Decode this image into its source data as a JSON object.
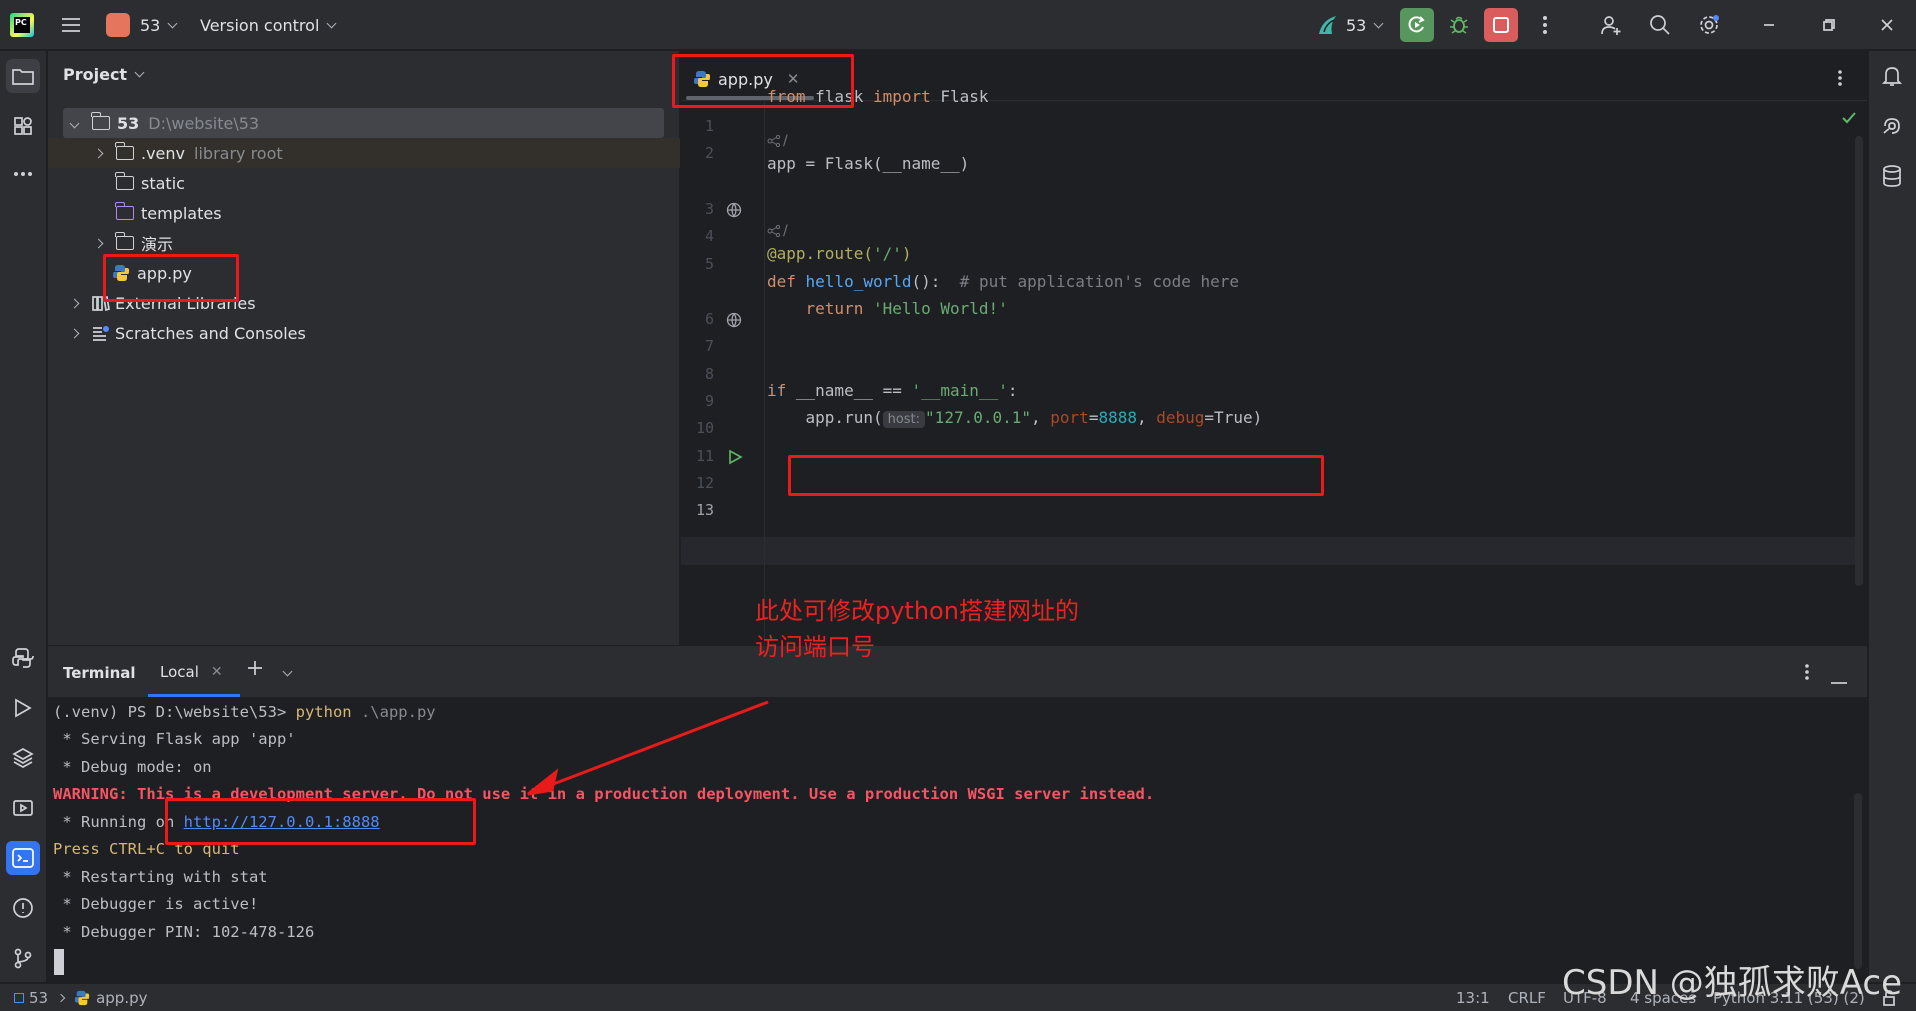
{
  "titlebar": {
    "project_badge": "53",
    "project_name": "53",
    "vcs_label": "Version control",
    "run_config": "53"
  },
  "project_panel": {
    "title": "Project",
    "tree": [
      {
        "label": "53",
        "path": "D:\\website\\53"
      },
      {
        "label": ".venv",
        "note": "library root"
      },
      {
        "label": "static"
      },
      {
        "label": "templates"
      },
      {
        "label": "演示"
      },
      {
        "label": "app.py"
      },
      {
        "label": "External Libraries"
      },
      {
        "label": "Scratches and Consoles"
      }
    ]
  },
  "editor": {
    "tab_label": "app.py",
    "line_numbers": [
      "1",
      "2",
      "3",
      "4",
      "5",
      "6",
      "7",
      "8",
      "9",
      "10",
      "11",
      "12",
      "13"
    ],
    "usages_marker": "/",
    "code": {
      "l1_kw1": "from",
      "l1_mod": " flask ",
      "l1_kw2": "import",
      "l1_name": " Flask",
      "l3": "app = Flask(__name__)",
      "l6_dec": "@app.route(",
      "l6_str": "'/'",
      "l6_end": ")",
      "l7_kw": "def",
      "l7_fn": " hello_world",
      "l7_rest": "():  ",
      "l7_cmt": "# put application's code here",
      "l8_indent": "    ",
      "l8_kw": "return",
      "l8_str": " 'Hello World!'",
      "l11_kw": "if",
      "l11_mid": " __name__ == ",
      "l11_str": "'__main__'",
      "l11_end": ":",
      "l12_start": "    app.run(",
      "l12_hint": "host:",
      "l12_str": "\"127.0.0.1\"",
      "l12_c1": ", ",
      "l12_p1": "port",
      "l12_eq1": "=",
      "l12_num": "8888",
      "l12_c2": ", ",
      "l12_p2": "debug",
      "l12_eq2": "=True)"
    }
  },
  "annotation": {
    "line1": "此处可修改python搭建网址的",
    "line2": "访问端口号"
  },
  "terminal": {
    "title": "Terminal",
    "tab_label": "Local",
    "prompt": "(.venv) PS D:\\website\\53> ",
    "cmd": "python",
    "arg": " .\\app.py",
    "lines": [
      " * Serving Flask app 'app'",
      " * Debug mode: on"
    ],
    "warning": "WARNING: This is a development server. Do not use it in a production deployment. Use a production WSGI server instead.",
    "running_prefix": " * Running on ",
    "running_url": "http://127.0.0.1:8888",
    "quit_hint": "Press CTRL+C to quit",
    "after_lines": [
      " * Restarting with stat",
      " * Debugger is active!",
      " * Debugger PIN: 102-478-126"
    ]
  },
  "statusbar": {
    "project": "53",
    "file": "app.py",
    "position": "13:1",
    "line_sep": "CRLF",
    "encoding": "UTF-8",
    "indent": "4 spaces",
    "interpreter": "Python 3.11 (53) (2)"
  },
  "watermark": "CSDN @独孤求败Ace",
  "colors": {
    "accent_green": "#57965c",
    "stop_red": "#db5c5c",
    "annotation_red": "#e81a1a"
  }
}
